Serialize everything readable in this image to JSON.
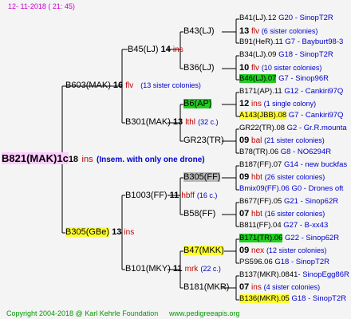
{
  "header": {
    "timestamp": "12- 11-2018 ( 21: 45)"
  },
  "root": {
    "id": "B821(MAK)1c",
    "num": "18",
    "suffix": "ins",
    "note": "(Insem. with only one drone)"
  },
  "gen1": [
    {
      "id": "B603(MAK)",
      "num": "16",
      "suffix": "flv",
      "note": "(13 sister colonies)"
    },
    {
      "id": "B305(GBe)",
      "num": "13",
      "suffix": "ins",
      "note": ""
    }
  ],
  "gen2": [
    {
      "id": "B45(LJ)",
      "num": "14",
      "suffix": "ins",
      "note": ""
    },
    {
      "id": "B301(MAK)",
      "num": "13",
      "suffix": "lthl",
      "note": "(32 c.)"
    },
    {
      "id": "B1003(FF)",
      "num": "11",
      "suffix": "hbff",
      "note": "(16 c.)"
    },
    {
      "id": "B101(MKY)",
      "num": "11",
      "suffix": "mrk",
      "note": "(22 c.)"
    }
  ],
  "gen3": [
    {
      "id": "B43(LJ)",
      "num": "13",
      "suffix": "flv",
      "note": "(6 sister colonies)"
    },
    {
      "id": "B36(LJ)",
      "num": "10",
      "suffix": "flv",
      "note": "(10 sister colonies)"
    },
    {
      "id": "B6(AP)",
      "num": "12",
      "suffix": "ins",
      "note": "(1 single colony)"
    },
    {
      "id": "GR23(TR)",
      "num": "09",
      "suffix": "bal",
      "note": "(21 sister colonies)"
    },
    {
      "id": "B305(FF)",
      "num": "09",
      "suffix": "hbt",
      "note": "(26 sister colonies)"
    },
    {
      "id": "B58(FF)",
      "num": "07",
      "suffix": "hbt",
      "note": "(16 sister colonies)"
    },
    {
      "id": "B47(MKK)",
      "num": "09",
      "suffix": "nex",
      "note": "(12 sister colonies)"
    },
    {
      "id": "B181(MKR)",
      "num": "07",
      "suffix": "ins",
      "note": "(4 sister colonies)"
    }
  ],
  "gen4": [
    {
      "id": "B41(LJ).12",
      "source": "G20 - SinopT2R"
    },
    {
      "id": "B91(HeR).11",
      "source": "G7 - Bayburt98-3"
    },
    {
      "id": "B34(LJ).09",
      "source": "G18 - SinopT2R"
    },
    {
      "id": "B46(LJ).07",
      "source": "G7 - Sinop96R"
    },
    {
      "id": "B171(AP).11",
      "source": "G12 - Cankiri97Q"
    },
    {
      "id": "A143(JBB).08",
      "source": "G7 - Cankiri97Q"
    },
    {
      "id": "GR22(TR).08",
      "source": "G2 - Gr.R.mounta"
    },
    {
      "id": "B78(TR).06",
      "source": "G8 - NO6294R"
    },
    {
      "id": "B187(FF).07",
      "source": "G14 - new buckfas"
    },
    {
      "id": "Bmix09(FF).06",
      "source": "G0 - Drones oft"
    },
    {
      "id": "B677(FF).05",
      "source": "G21 - Sinop62R"
    },
    {
      "id": "B811(FF).04",
      "source": "G27 - B-xx43"
    },
    {
      "id": "B171(TR).06",
      "source": "G22 - Sinop62R"
    },
    {
      "id": "PS596.06",
      "source": "G18 - SinopT2R"
    },
    {
      "id": "B137(MKR).0841",
      "source": "- SinopEgg86R"
    },
    {
      "id": "B136(MKR).05",
      "source": "G18 - SinopT2R"
    }
  ],
  "footer": {
    "copyright": "Copyright 2004-2018 @ Karl Kehrle Foundation",
    "site": "www.pedigreeapis.org"
  }
}
